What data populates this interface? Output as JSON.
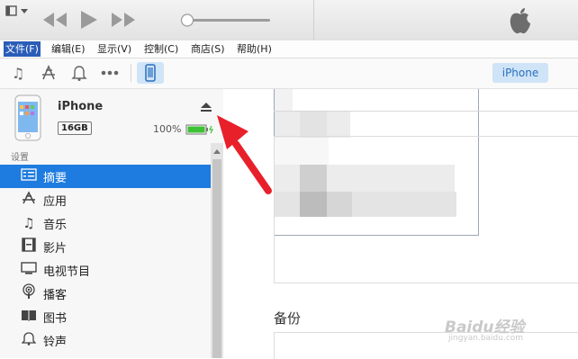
{
  "menu": {
    "items": [
      "文件(F)",
      "编辑(E)",
      "显示(V)",
      "控制(C)",
      "商店(S)",
      "帮助(H)"
    ]
  },
  "toolbar": {
    "device_button_label": "iPhone"
  },
  "device": {
    "name": "iPhone",
    "capacity": "16GB",
    "battery_percent": "100%",
    "battery_level": 1.0
  },
  "sidebar": {
    "section_title": "设置",
    "items": [
      {
        "label": "摘要",
        "icon": "list-icon",
        "selected": true
      },
      {
        "label": "应用",
        "icon": "app-store-icon"
      },
      {
        "label": "音乐",
        "icon": "music-note-icon"
      },
      {
        "label": "影片",
        "icon": "film-icon"
      },
      {
        "label": "电视节目",
        "icon": "tv-icon"
      },
      {
        "label": "播客",
        "icon": "podcast-icon"
      },
      {
        "label": "图书",
        "icon": "book-icon"
      },
      {
        "label": "铃声",
        "icon": "bell-icon"
      }
    ]
  },
  "content": {
    "backup_title": "备份"
  },
  "watermark": {
    "brand": "Baidu经验",
    "url": "jingyan.baidu.com"
  },
  "colors": {
    "accent": "#1e7be0",
    "battery": "#3ec135",
    "annotation_arrow": "#e8202a"
  }
}
